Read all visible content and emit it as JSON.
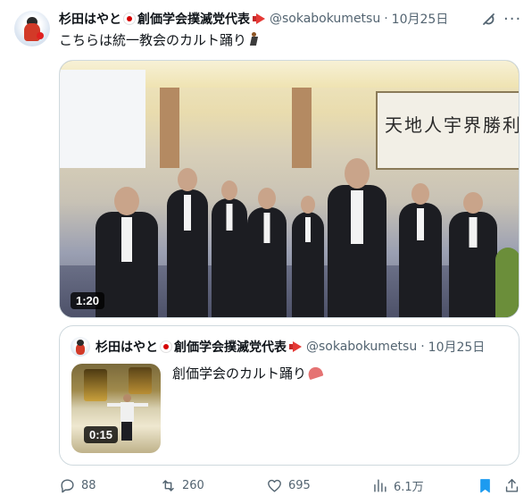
{
  "post": {
    "author": {
      "display_name_main": "杉田はやと",
      "display_name_rest": "創価学会撲滅党代表",
      "handle": "@sokabokumetsu",
      "separator": "·",
      "date": "10月25日"
    },
    "text": "こちらは統一教会のカルト踊り",
    "video": {
      "duration": "1:20",
      "banner_text": "天地人宇界勝利"
    },
    "quoted": {
      "display_name_main": "杉田はやと",
      "display_name_rest": "創価学会撲滅党代表",
      "handle": "@sokabokumetsu",
      "separator": "·",
      "date": "10月25日",
      "text": "創価学会のカルト踊り",
      "video_duration": "0:15"
    },
    "actions": {
      "replies": "88",
      "reposts": "260",
      "likes": "695",
      "views": "6.1万"
    }
  },
  "colors": {
    "text": "#0f1419",
    "secondary": "#536471",
    "border": "#cfd9de",
    "bookmark_active": "#1d9bf0"
  },
  "icons": {
    "grok": "grok-icon",
    "more": "more-icon",
    "reply": "reply-icon",
    "repost": "repost-icon",
    "like": "like-icon",
    "views": "views-icon",
    "bookmark": "bookmark-icon",
    "share": "share-icon"
  }
}
